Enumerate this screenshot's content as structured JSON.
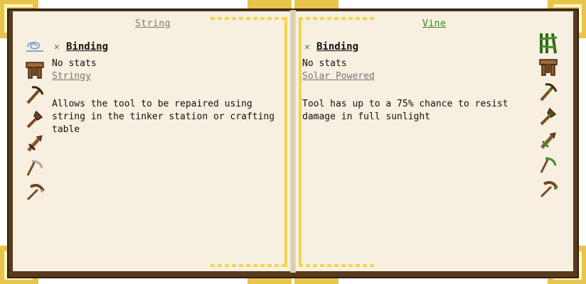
{
  "left_page": {
    "title": "String",
    "heading": "Binding",
    "stats": "No stats",
    "trait": "Stringy",
    "description": "Allows the tool to be repaired using string in the tinker station or crafting table",
    "icons": [
      "string-icon",
      "tool-forge-icon",
      "pickaxe-icon",
      "hatchet-icon",
      "broadsword-icon",
      "scythe-icon",
      "hammer-icon"
    ]
  },
  "right_page": {
    "title": "Vine",
    "heading": "Binding",
    "stats": "No stats",
    "trait": "Solar Powered",
    "description": "Tool has up to a 75% chance to resist damage in full sunlight",
    "icons": [
      "vine-icon",
      "tool-forge-icon",
      "pickaxe-icon",
      "hatchet-icon",
      "broadsword-icon",
      "scythe-icon",
      "hammer-icon"
    ]
  },
  "colors": {
    "string_title": "#7c7c7c",
    "vine_title": "#2f8a1e",
    "gold": "#e8c44a",
    "page": "#f7efdf",
    "wood": "#8a5a2b"
  }
}
